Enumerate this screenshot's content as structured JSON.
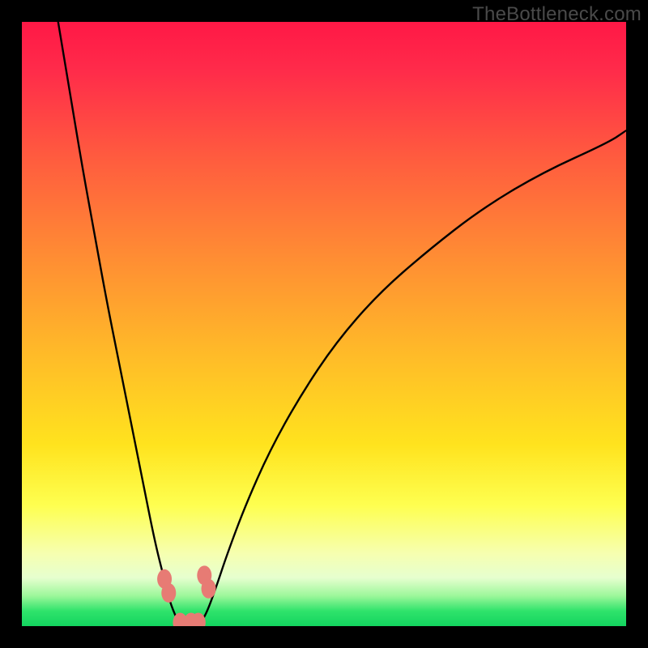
{
  "watermark": "TheBottleneck.com",
  "chart_data": {
    "type": "line",
    "title": "",
    "xlabel": "",
    "ylabel": "",
    "xlim": [
      0,
      100
    ],
    "ylim": [
      0,
      100
    ],
    "series": [
      {
        "name": "left-curve",
        "x": [
          6,
          8,
          10,
          12,
          14,
          16,
          18,
          20,
          22,
          23.5,
          24.5,
          25.5,
          26
        ],
        "y": [
          100,
          88,
          76,
          65,
          54,
          44,
          34,
          24,
          14,
          8,
          4,
          1.5,
          0.5
        ]
      },
      {
        "name": "right-curve",
        "x": [
          29.5,
          30.5,
          32,
          34,
          37,
          41,
          46,
          52,
          59,
          67,
          76,
          86,
          97,
          100
        ],
        "y": [
          0.5,
          2,
          6,
          12,
          20,
          29,
          38,
          47,
          55,
          62,
          69,
          75,
          80,
          82
        ]
      },
      {
        "name": "flat-bottom",
        "x": [
          26,
          29.5
        ],
        "y": [
          0.5,
          0.5
        ]
      }
    ],
    "markers": [
      {
        "name": "pink-dot",
        "x": 23.6,
        "y": 7.8
      },
      {
        "name": "pink-dot",
        "x": 24.3,
        "y": 5.5
      },
      {
        "name": "pink-dot",
        "x": 30.2,
        "y": 8.4
      },
      {
        "name": "pink-dot",
        "x": 30.9,
        "y": 6.2
      },
      {
        "name": "pink-dot",
        "x": 26.2,
        "y": 0.6
      },
      {
        "name": "pink-dot",
        "x": 28.0,
        "y": 0.6
      },
      {
        "name": "pink-dot",
        "x": 29.2,
        "y": 0.6
      }
    ],
    "colors": {
      "curve": "#000000",
      "marker": "#e77b74",
      "gradient_top": "#ff1846",
      "gradient_bottom": "#13d45f"
    }
  }
}
